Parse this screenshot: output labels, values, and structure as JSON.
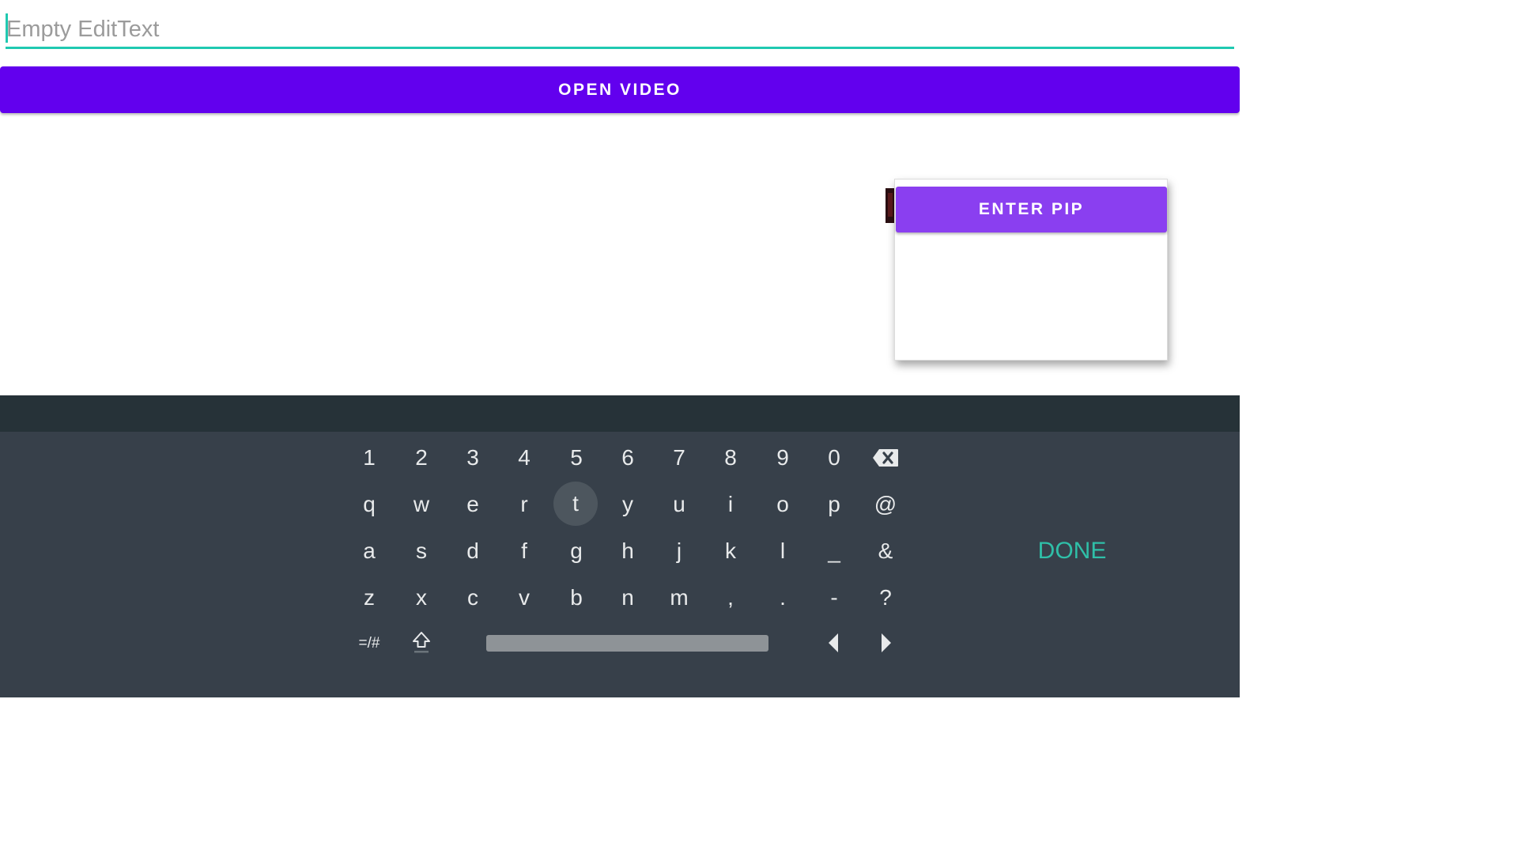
{
  "edit_text": {
    "placeholder": "Empty EditText"
  },
  "open_video_button": {
    "label": "OPEN VIDEO"
  },
  "pip": {
    "enter_pip_label": "ENTER PIP"
  },
  "keyboard": {
    "row_numbers": [
      "1",
      "2",
      "3",
      "4",
      "5",
      "6",
      "7",
      "8",
      "9",
      "0"
    ],
    "row_q": [
      "q",
      "w",
      "e",
      "r",
      "t",
      "y",
      "u",
      "i",
      "o",
      "p",
      "@"
    ],
    "row_a": [
      "a",
      "s",
      "d",
      "f",
      "g",
      "h",
      "j",
      "k",
      "l",
      "_",
      "&"
    ],
    "row_z": [
      "z",
      "x",
      "c",
      "v",
      "b",
      "n",
      "m",
      ",",
      ".",
      "-",
      "?"
    ],
    "symbols_label": "=/#",
    "done_label": "DONE",
    "focused_key": "t"
  },
  "colors": {
    "accent_teal": "#20c9b1",
    "primary_purple": "#6200ee",
    "pip_purple": "#8a3ff0",
    "keyboard_bg": "#37404a",
    "keyboard_topbar": "#263238",
    "done_text": "#2fbfa8"
  }
}
